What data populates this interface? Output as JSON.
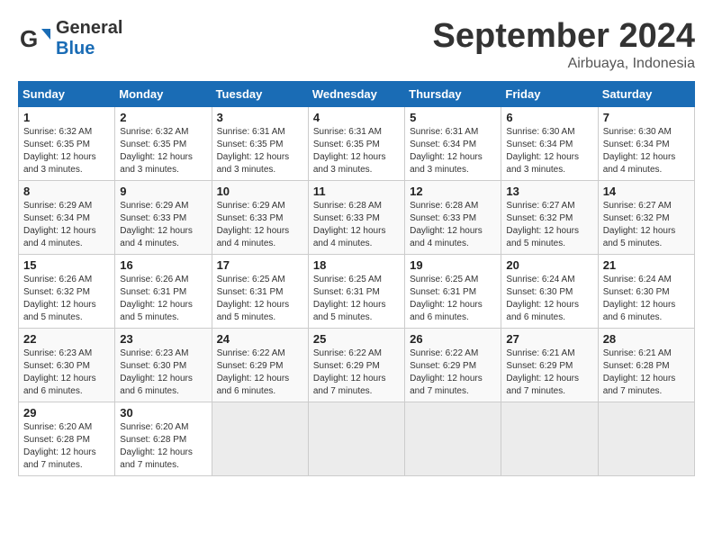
{
  "logo": {
    "line1": "General",
    "line2": "Blue"
  },
  "title": "September 2024",
  "location": "Airbuaya, Indonesia",
  "headers": [
    "Sunday",
    "Monday",
    "Tuesday",
    "Wednesday",
    "Thursday",
    "Friday",
    "Saturday"
  ],
  "weeks": [
    [
      {
        "day": "1",
        "sunrise": "6:32 AM",
        "sunset": "6:35 PM",
        "daylight": "12 hours and 3 minutes."
      },
      {
        "day": "2",
        "sunrise": "6:32 AM",
        "sunset": "6:35 PM",
        "daylight": "12 hours and 3 minutes."
      },
      {
        "day": "3",
        "sunrise": "6:31 AM",
        "sunset": "6:35 PM",
        "daylight": "12 hours and 3 minutes."
      },
      {
        "day": "4",
        "sunrise": "6:31 AM",
        "sunset": "6:35 PM",
        "daylight": "12 hours and 3 minutes."
      },
      {
        "day": "5",
        "sunrise": "6:31 AM",
        "sunset": "6:34 PM",
        "daylight": "12 hours and 3 minutes."
      },
      {
        "day": "6",
        "sunrise": "6:30 AM",
        "sunset": "6:34 PM",
        "daylight": "12 hours and 3 minutes."
      },
      {
        "day": "7",
        "sunrise": "6:30 AM",
        "sunset": "6:34 PM",
        "daylight": "12 hours and 4 minutes."
      }
    ],
    [
      {
        "day": "8",
        "sunrise": "6:29 AM",
        "sunset": "6:34 PM",
        "daylight": "12 hours and 4 minutes."
      },
      {
        "day": "9",
        "sunrise": "6:29 AM",
        "sunset": "6:33 PM",
        "daylight": "12 hours and 4 minutes."
      },
      {
        "day": "10",
        "sunrise": "6:29 AM",
        "sunset": "6:33 PM",
        "daylight": "12 hours and 4 minutes."
      },
      {
        "day": "11",
        "sunrise": "6:28 AM",
        "sunset": "6:33 PM",
        "daylight": "12 hours and 4 minutes."
      },
      {
        "day": "12",
        "sunrise": "6:28 AM",
        "sunset": "6:33 PM",
        "daylight": "12 hours and 4 minutes."
      },
      {
        "day": "13",
        "sunrise": "6:27 AM",
        "sunset": "6:32 PM",
        "daylight": "12 hours and 5 minutes."
      },
      {
        "day": "14",
        "sunrise": "6:27 AM",
        "sunset": "6:32 PM",
        "daylight": "12 hours and 5 minutes."
      }
    ],
    [
      {
        "day": "15",
        "sunrise": "6:26 AM",
        "sunset": "6:32 PM",
        "daylight": "12 hours and 5 minutes."
      },
      {
        "day": "16",
        "sunrise": "6:26 AM",
        "sunset": "6:31 PM",
        "daylight": "12 hours and 5 minutes."
      },
      {
        "day": "17",
        "sunrise": "6:25 AM",
        "sunset": "6:31 PM",
        "daylight": "12 hours and 5 minutes."
      },
      {
        "day": "18",
        "sunrise": "6:25 AM",
        "sunset": "6:31 PM",
        "daylight": "12 hours and 5 minutes."
      },
      {
        "day": "19",
        "sunrise": "6:25 AM",
        "sunset": "6:31 PM",
        "daylight": "12 hours and 6 minutes."
      },
      {
        "day": "20",
        "sunrise": "6:24 AM",
        "sunset": "6:30 PM",
        "daylight": "12 hours and 6 minutes."
      },
      {
        "day": "21",
        "sunrise": "6:24 AM",
        "sunset": "6:30 PM",
        "daylight": "12 hours and 6 minutes."
      }
    ],
    [
      {
        "day": "22",
        "sunrise": "6:23 AM",
        "sunset": "6:30 PM",
        "daylight": "12 hours and 6 minutes."
      },
      {
        "day": "23",
        "sunrise": "6:23 AM",
        "sunset": "6:30 PM",
        "daylight": "12 hours and 6 minutes."
      },
      {
        "day": "24",
        "sunrise": "6:22 AM",
        "sunset": "6:29 PM",
        "daylight": "12 hours and 6 minutes."
      },
      {
        "day": "25",
        "sunrise": "6:22 AM",
        "sunset": "6:29 PM",
        "daylight": "12 hours and 7 minutes."
      },
      {
        "day": "26",
        "sunrise": "6:22 AM",
        "sunset": "6:29 PM",
        "daylight": "12 hours and 7 minutes."
      },
      {
        "day": "27",
        "sunrise": "6:21 AM",
        "sunset": "6:29 PM",
        "daylight": "12 hours and 7 minutes."
      },
      {
        "day": "28",
        "sunrise": "6:21 AM",
        "sunset": "6:28 PM",
        "daylight": "12 hours and 7 minutes."
      }
    ],
    [
      {
        "day": "29",
        "sunrise": "6:20 AM",
        "sunset": "6:28 PM",
        "daylight": "12 hours and 7 minutes."
      },
      {
        "day": "30",
        "sunrise": "6:20 AM",
        "sunset": "6:28 PM",
        "daylight": "12 hours and 7 minutes."
      },
      null,
      null,
      null,
      null,
      null
    ]
  ]
}
